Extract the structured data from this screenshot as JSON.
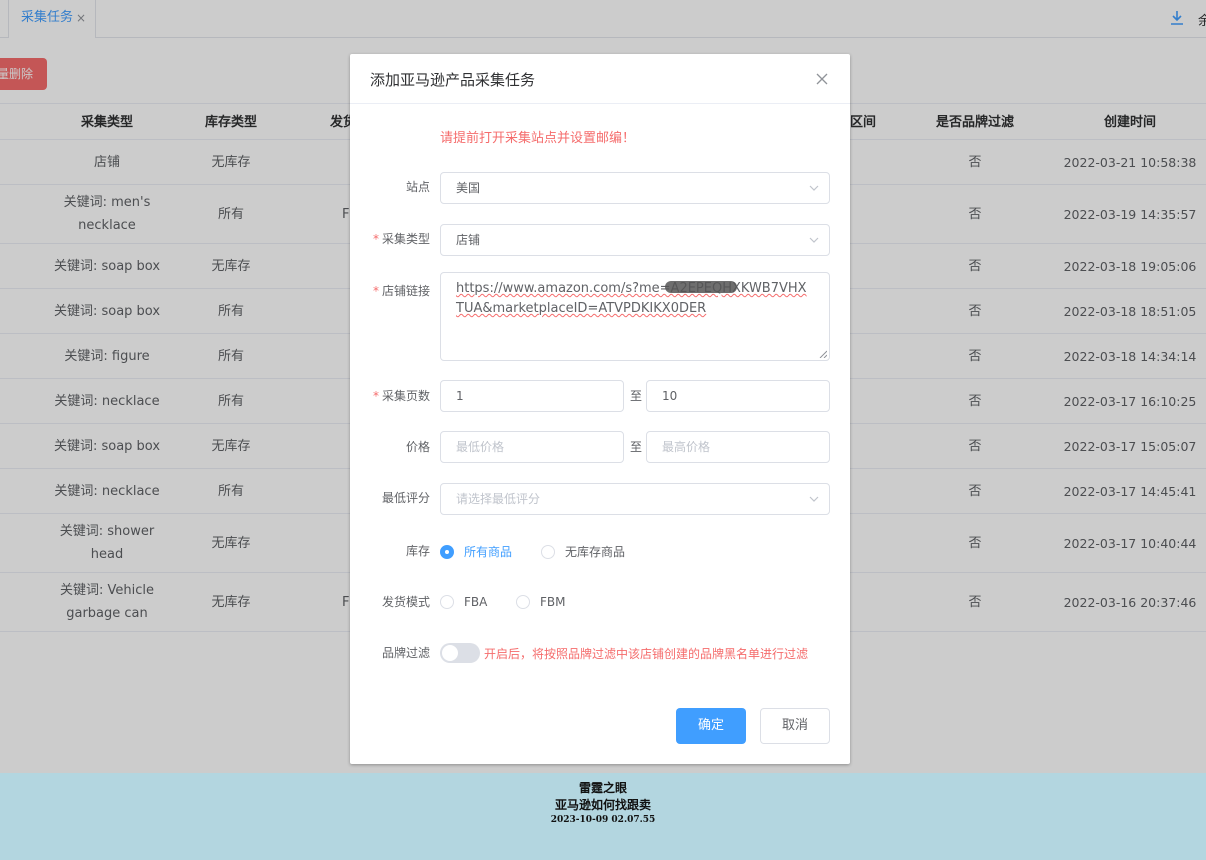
{
  "tabs": {
    "active_label": "采集任务",
    "close": "×"
  },
  "right_cut_text": "余",
  "toolbar": {
    "bulk_delete_label": "量删除"
  },
  "table": {
    "headers": {
      "collect_type": "采集类型",
      "stock_type": "库存类型",
      "ship_mode": "发货",
      "range": "区间",
      "brand_filter": "是否品牌过滤",
      "created_at": "创建时间"
    },
    "rows": [
      {
        "type": "店铺",
        "stock": "无库存",
        "ship": "",
        "range": "-",
        "brand": "否",
        "time": "2022-03-21 10:58:38"
      },
      {
        "type": "关键词: men's necklace",
        "stock": "所有",
        "ship": "FI",
        "range": "-",
        "brand": "否",
        "time": "2022-03-19 14:35:57"
      },
      {
        "type": "关键词: soap box",
        "stock": "无库存",
        "ship": "",
        "range": "-",
        "brand": "否",
        "time": "2022-03-18 19:05:06"
      },
      {
        "type": "关键词: soap box",
        "stock": "所有",
        "ship": "",
        "range": "-",
        "brand": "否",
        "time": "2022-03-18 18:51:05"
      },
      {
        "type": "关键词: figure",
        "stock": "所有",
        "ship": "",
        "range": "-",
        "brand": "否",
        "time": "2022-03-18 14:34:14"
      },
      {
        "type": "关键词: necklace",
        "stock": "所有",
        "ship": "",
        "range": "-",
        "brand": "否",
        "time": "2022-03-17 16:10:25"
      },
      {
        "type": "关键词: soap box",
        "stock": "无库存",
        "ship": "",
        "range": "-",
        "brand": "否",
        "time": "2022-03-17 15:05:07"
      },
      {
        "type": "关键词: necklace",
        "stock": "所有",
        "ship": "",
        "range": "-",
        "brand": "否",
        "time": "2022-03-17 14:45:41"
      },
      {
        "type": "关键词: shower head",
        "stock": "无库存",
        "ship": "",
        "range": "-",
        "brand": "否",
        "time": "2022-03-17 10:40:44"
      },
      {
        "type": "关键词: Vehicle garbage can",
        "stock": "无库存",
        "ship": "FI",
        "range": "-",
        "brand": "否",
        "time": "2022-03-16 20:37:46"
      }
    ]
  },
  "dialog": {
    "title": "添加亚马逊产品采集任务",
    "warning": "请提前打开采集站点并设置邮编！",
    "required_mark": "*",
    "fields": {
      "site": {
        "label": "站点",
        "value": "美国"
      },
      "collect_type": {
        "label": "采集类型",
        "value": "店铺"
      },
      "store_link": {
        "label": "店铺链接",
        "value": "https://www.amazon.com/s?me=A2EPEQHXKWB7VHXTUA&marketplaceID=ATVPDKIKX0DER"
      },
      "pages": {
        "label": "采集页数",
        "from": "1",
        "to_sep": "至",
        "to": "10"
      },
      "price": {
        "label": "价格",
        "min_placeholder": "最低价格",
        "to_sep": "至",
        "max_placeholder": "最高价格"
      },
      "rating": {
        "label": "最低评分",
        "placeholder": "请选择最低评分"
      },
      "stock": {
        "label": "库存",
        "options": [
          "所有商品",
          "无库存商品"
        ],
        "selected": "所有商品"
      },
      "ship_mode": {
        "label": "发货模式",
        "options": [
          "FBA",
          "FBM"
        ]
      },
      "brand_filter": {
        "label": "品牌过滤",
        "enabled": false,
        "tip": "开启后，将按照品牌过滤中该店铺创建的品牌黑名单进行过滤"
      }
    },
    "confirm_label": "确定",
    "cancel_label": "取消"
  },
  "footer": {
    "line1": "雷霆之眼",
    "line2": "亚马逊如何找跟卖",
    "line3": "2023-10-09 02.07.55"
  },
  "colors": {
    "primary": "#409eff",
    "danger": "#f56c6c",
    "footer_bg": "#b3d6e0"
  }
}
